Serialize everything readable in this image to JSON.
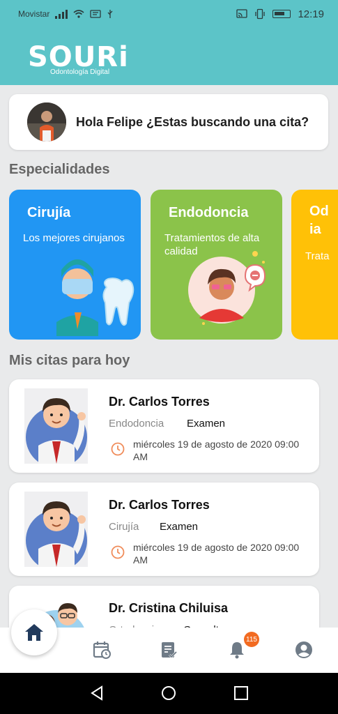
{
  "status_bar": {
    "carrier": "Movistar",
    "time": "12:19"
  },
  "header": {
    "logo_word": "SOURi",
    "logo_sub": "Odontología Digital"
  },
  "greeting": {
    "text": "Hola Felipe ¿Estas buscando una cita?"
  },
  "specialties": {
    "title": "Especialidades",
    "items": [
      {
        "name": "Cirujía",
        "desc": "Los mejores cirujanos",
        "color": "#2196f3"
      },
      {
        "name": "Endodoncia",
        "desc": "Tratamientos de alta calidad",
        "color": "#8bc34a"
      },
      {
        "name": "Od\nia",
        "desc": "Trata",
        "color": "#ffc107"
      }
    ]
  },
  "appointments": {
    "title": "Mis citas para hoy",
    "items": [
      {
        "doctor": "Dr. Carlos Torres",
        "specialty": "Endodoncia",
        "type": "Examen",
        "date": "miércoles 19 de agosto de 2020 09:00 AM"
      },
      {
        "doctor": "Dr. Carlos Torres",
        "specialty": "Cirujía",
        "type": "Examen",
        "date": "miércoles 19 de agosto de 2020 09:00 AM"
      },
      {
        "doctor": "Dr. Cristina Chiluisa",
        "specialty": "Ortodoncia",
        "type": "Consulta",
        "date": ""
      }
    ]
  },
  "bottom_nav": {
    "items": [
      "home-icon",
      "calendar-icon",
      "records-icon",
      "bell-icon",
      "profile-icon"
    ],
    "notification_count": "115"
  },
  "colors": {
    "header": "#5cc4c8",
    "accent_orange": "#f26b21",
    "icon_gray": "#6f7b87"
  }
}
